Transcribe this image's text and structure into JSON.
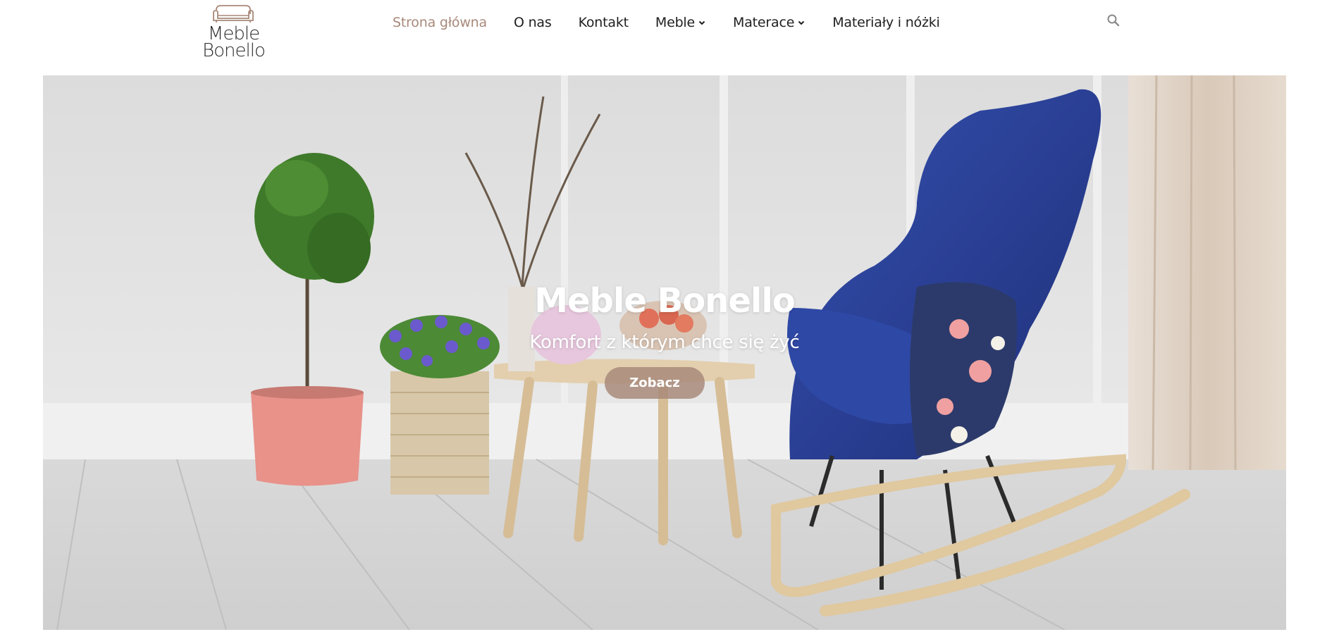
{
  "brand": {
    "logo_line1": "Meble",
    "logo_line2": "Bonello",
    "logo_icon": "sofa-icon"
  },
  "nav": {
    "items": [
      {
        "label": "Strona główna",
        "active": true,
        "dropdown": false
      },
      {
        "label": "O nas",
        "active": false,
        "dropdown": false
      },
      {
        "label": "Kontakt",
        "active": false,
        "dropdown": false
      },
      {
        "label": "Meble",
        "active": false,
        "dropdown": true
      },
      {
        "label": "Materace",
        "active": false,
        "dropdown": true
      },
      {
        "label": "Materiały i nóżki",
        "active": false,
        "dropdown": false
      }
    ],
    "search_icon": "search-icon"
  },
  "hero": {
    "title": "Meble Bonello",
    "subtitle": "Komfort z którym chce się żyć",
    "button_label": "Zobacz"
  },
  "colors": {
    "accent": "#a8897a",
    "text": "#1f1f1f",
    "chair_blue": "#2a3f93"
  }
}
